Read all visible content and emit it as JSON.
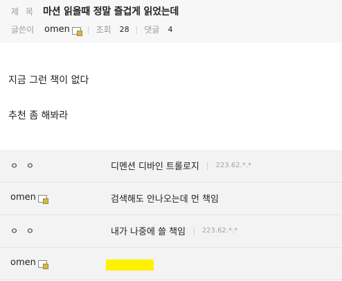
{
  "post": {
    "title_label": "제 목",
    "title": "마션 읽을때 정말 즐겁게 읽었는데",
    "author_label": "글쓴이",
    "author": "omen",
    "views_label": "조회",
    "views": "28",
    "comments_label": "댓글",
    "comments_count": "4",
    "body": [
      "지금 그런 책이 없다",
      "추천 좀 해봐라"
    ]
  },
  "comments": [
    {
      "author": "ㅇ ㅇ",
      "text": "디멘션 디바인 트롤로지",
      "ip": "223.62.*.*"
    },
    {
      "author": "omen",
      "text": "검색해도 안나오는데 먼 책임",
      "ip": ""
    },
    {
      "author": "ㅇ ㅇ",
      "text": "내가 나중에 쓸 책임",
      "ip": "223.62.*.*"
    },
    {
      "author": "omen",
      "text": "",
      "ip": ""
    }
  ],
  "icons": {
    "member_icon": "member-badge-icon"
  },
  "colors": {
    "highlight": "#fff200",
    "header_bg": "#f7f7f7",
    "comment_bg": "#f3f3f3"
  }
}
